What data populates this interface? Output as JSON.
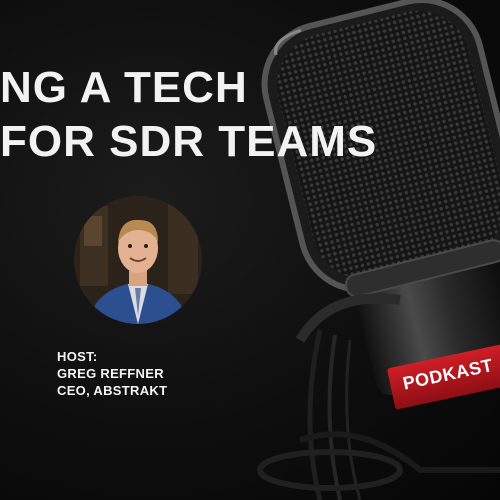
{
  "title": {
    "line1": "NG A TECH",
    "line2": "FOR SDR TEAMS"
  },
  "host": {
    "label": "HOST:",
    "name": "GREG REFFNER",
    "role": "CEO, ABSTRAKT"
  },
  "brand": {
    "mic_label": "PODKAST"
  },
  "colors": {
    "background": "#0e0e0e",
    "text": "#f2f2f2",
    "mic_band": "#b8161e",
    "suit": "#2c4f8f"
  },
  "icons": {
    "microphone": "microphone-icon",
    "host_photo": "host-avatar"
  }
}
